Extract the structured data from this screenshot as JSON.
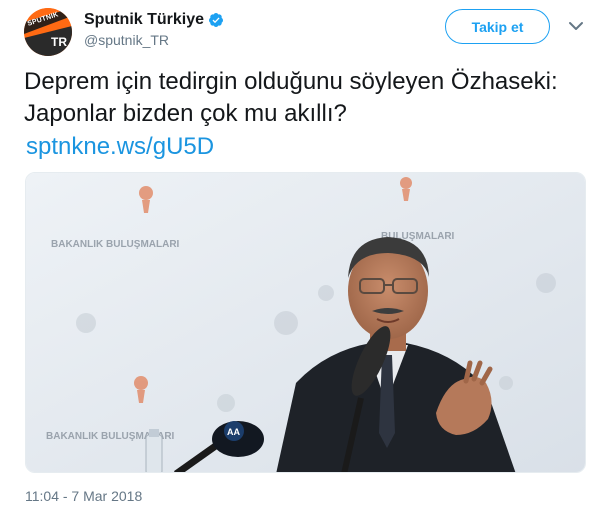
{
  "author": {
    "display_name": "Sputnik Türkiye",
    "handle": "@sputnik_TR",
    "verified": true,
    "avatar": {
      "brand_text": "SPUTNIK",
      "badge_text": "TR",
      "color": "#ff6a13"
    }
  },
  "follow_button": {
    "label": "Takip et"
  },
  "tweet": {
    "text": "Deprem için tedirgin olduğunu söyleyen Özhaseki: Japonlar bizden çok mu akıllı?",
    "link": "sptnkne.ws/gU5D",
    "timestamp": "11:04 - 7 Mar 2018"
  },
  "photo": {
    "backdrop_banner_left": "BAKANLIK BULUŞMALARI",
    "backdrop_banner_center": "BULUŞMALARI",
    "backdrop_banner_lower": "BAKANLIK BULUŞMALARI",
    "microphone_tag": "AA"
  },
  "colors": {
    "link_blue": "#1b95e0",
    "follow_blue": "#1da1f2",
    "secondary_text": "#657786",
    "verified_blue": "#1da1f2"
  }
}
